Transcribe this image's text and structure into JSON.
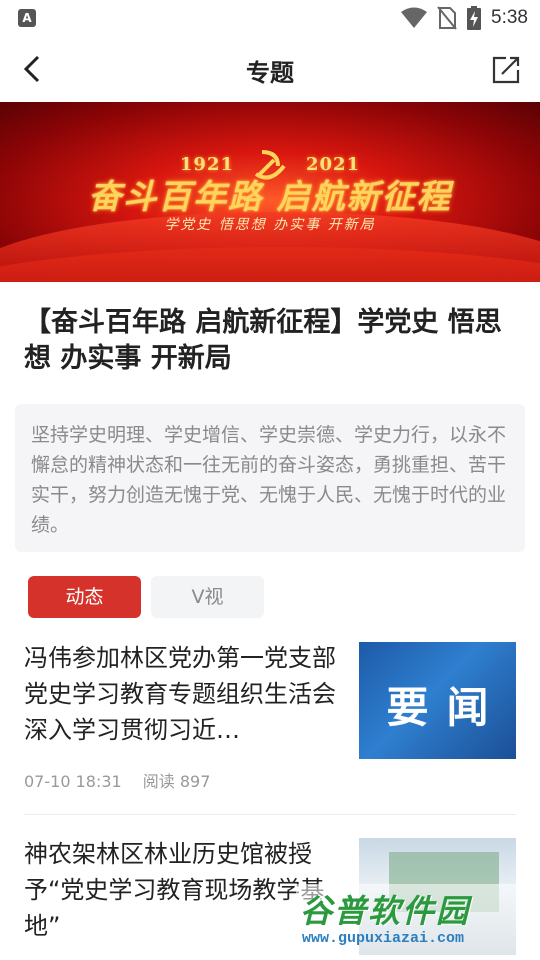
{
  "status_bar": {
    "time": "5:38",
    "icons": [
      "app-a-icon",
      "wifi-icon",
      "no-sim-icon",
      "battery-charging-icon"
    ],
    "app_letter": "A"
  },
  "nav": {
    "title": "专题",
    "back_icon": "back-chevron-icon",
    "share_icon": "share-external-icon"
  },
  "banner": {
    "year_left": "1921",
    "year_right": "2021",
    "title": "奋斗百年路 启航新征程",
    "subtitle": "学党史 悟思想 办实事 开新局"
  },
  "topic": {
    "title": "【奋斗百年路 启航新征程】学党史 悟思想 办实事 开新局",
    "description": "坚持学史明理、学史增信、学史崇德、学史力行，以永不懈怠的精神状态和一往无前的奋斗姿态，勇挑重担、苦干实干，努力创造无愧于党、无愧于人民、无愧于时代的业绩。"
  },
  "tabs": [
    {
      "label": "动态",
      "active": true
    },
    {
      "label": "V视",
      "active": false
    }
  ],
  "news": [
    {
      "title": "冯伟参加林区党办第一党支部党史学习教育专题组织生活会 深入学习贯彻习近…",
      "time": "07-10 18:31",
      "reads": "阅读 897",
      "thumb_text": "要闻"
    },
    {
      "title": "神农架林区林业历史馆被授予“党史学习教育现场教学基地”"
    }
  ],
  "watermark": {
    "logo": "谷普软件园",
    "url": "www.gupuxiazai.com"
  },
  "colors": {
    "accent": "#d4322a",
    "tab_inactive_bg": "#f3f4f6",
    "desc_bg": "#f5f5f7"
  }
}
